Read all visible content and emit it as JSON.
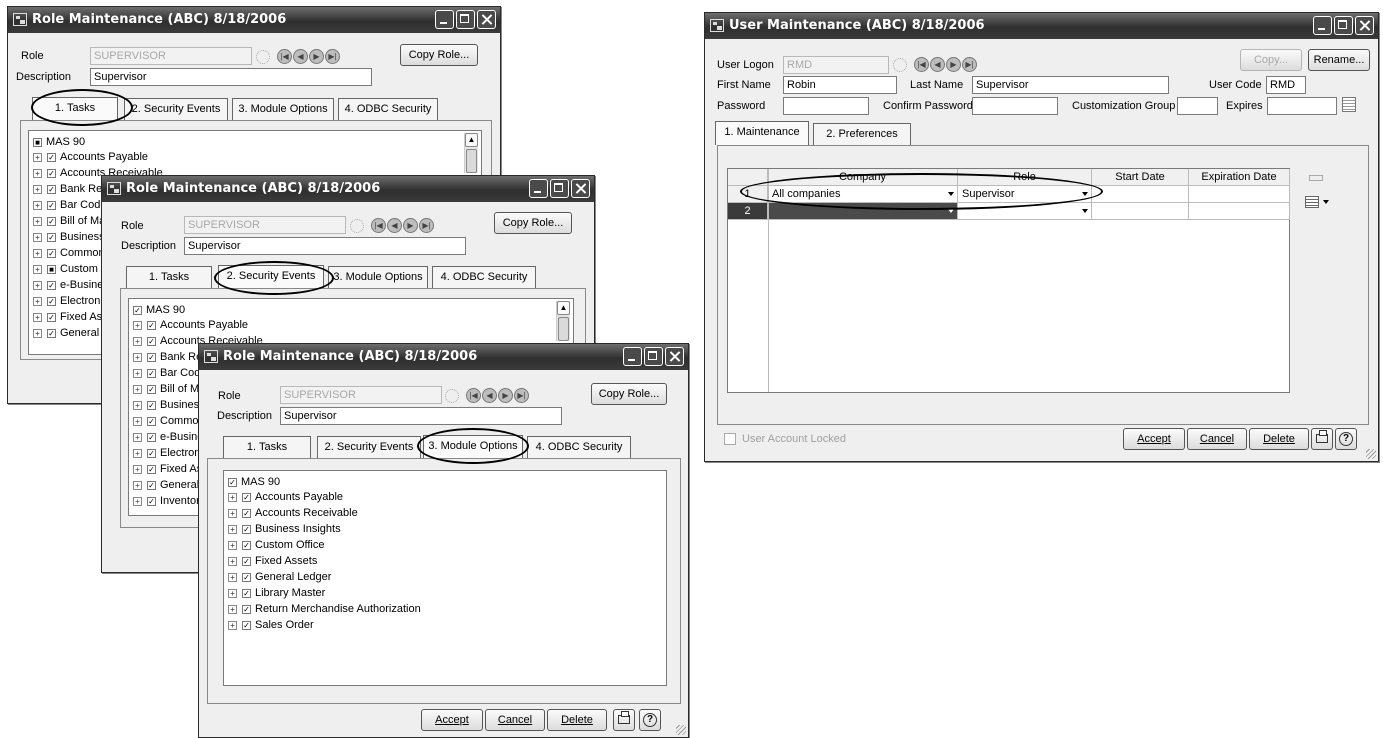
{
  "role_win": {
    "title": "Role Maintenance (ABC) 8/18/2006",
    "role_label": "Role",
    "role_value": "SUPERVISOR",
    "description_label": "Description",
    "description_value": "Supervisor",
    "copy_role": "Copy Role...",
    "tabs": [
      "1. Tasks",
      "2. Security Events",
      "3. Module Options",
      "4. ODBC Security"
    ],
    "root": "MAS 90"
  },
  "tasks_tree": [
    "Accounts Payable",
    "Accounts Receivable",
    "Bank Reconciliation",
    "Bar Code",
    "Bill of Materials",
    "Business Insights",
    "Common Information",
    "Custom Office",
    "e-Business Manager",
    "Electronic Reporting",
    "Fixed Assets",
    "General Ledger"
  ],
  "events_tree": [
    "Accounts Payable",
    "Accounts Receivable",
    "Bank Reconciliation",
    "Bar Code",
    "Bill of Materials",
    "Business Insights",
    "Common Information",
    "e-Business Manager",
    "Electronic Reporting",
    "Fixed Assets",
    "General Ledger",
    "Inventory Management"
  ],
  "options_tree": [
    "Accounts Payable",
    "Accounts Receivable",
    "Business Insights",
    "Custom Office",
    "Fixed Assets",
    "General Ledger",
    "Library Master",
    "Return Merchandise Authorization",
    "Sales Order"
  ],
  "buttons": {
    "accept": "Accept",
    "cancel": "Cancel",
    "delete": "Delete"
  },
  "user_win": {
    "title": "User Maintenance (ABC) 8/18/2006",
    "logon_label": "User Logon",
    "logon_value": "RMD",
    "copy": "Copy...",
    "rename": "Rename...",
    "first_label": "First Name",
    "first_value": "Robin",
    "last_label": "Last Name",
    "last_value": "Supervisor",
    "code_label": "User Code",
    "code_value": "RMD",
    "password_label": "Password",
    "confirm_label": "Confirm Password",
    "custgroup_label": "Customization Group",
    "expires_label": "Expires",
    "tabs": [
      "1. Maintenance",
      "2. Preferences"
    ],
    "columns": [
      "Company",
      "Role",
      "Start Date",
      "Expiration Date"
    ],
    "rows": [
      {
        "num": "1",
        "company": "All companies",
        "role": "Supervisor",
        "start": "",
        "expiration": ""
      },
      {
        "num": "2",
        "company": "",
        "role": "",
        "start": "",
        "expiration": ""
      }
    ],
    "locked_label": "User Account Locked"
  },
  "icons": [
    "app-icon",
    "minimize-icon",
    "maximize-icon",
    "close-icon",
    "lookup-icon",
    "first-record-icon",
    "previous-record-icon",
    "next-record-icon",
    "last-record-icon",
    "expand-icon",
    "checkbox-icon",
    "print-icon",
    "help-icon",
    "calendar-icon",
    "grid-options-icon"
  ],
  "colors": {
    "titlebar": "#3a3a3a",
    "window_bg": "#efefef",
    "annotation_oval": "#000000"
  }
}
